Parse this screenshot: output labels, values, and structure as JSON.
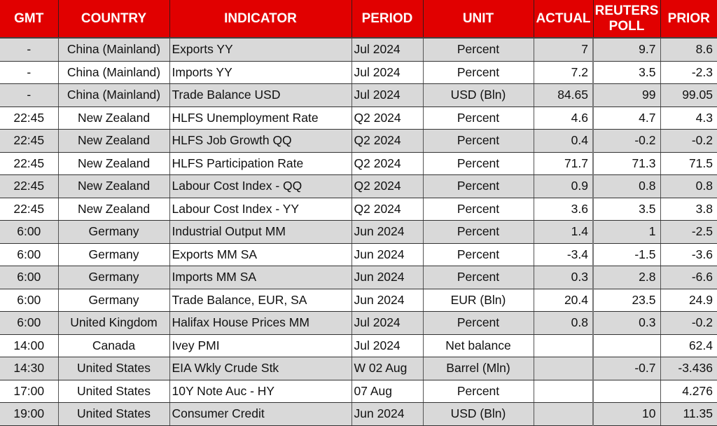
{
  "header": {
    "gmt": "GMT",
    "country": "COUNTRY",
    "indicator": "INDICATOR",
    "period": "PERIOD",
    "unit": "UNIT",
    "actual": "ACTUAL",
    "poll_line1": "REUTERS",
    "poll_line2": "POLL",
    "prior": "PRIOR"
  },
  "colors": {
    "header_bg": "#e10000",
    "header_text": "#ffffff",
    "row_alt_bg": "#d9d9d9",
    "row_bg": "#ffffff"
  },
  "rows": [
    {
      "gmt": "-",
      "country": "China (Mainland)",
      "indicator": "Exports YY",
      "period": "Jul 2024",
      "unit": "Percent",
      "actual": "7",
      "poll": "9.7",
      "prior": "8.6"
    },
    {
      "gmt": "-",
      "country": "China (Mainland)",
      "indicator": "Imports YY",
      "period": "Jul 2024",
      "unit": "Percent",
      "actual": "7.2",
      "poll": "3.5",
      "prior": "-2.3"
    },
    {
      "gmt": "-",
      "country": "China (Mainland)",
      "indicator": "Trade Balance USD",
      "period": "Jul 2024",
      "unit": "USD (Bln)",
      "actual": "84.65",
      "poll": "99",
      "prior": "99.05"
    },
    {
      "gmt": "22:45",
      "country": "New Zealand",
      "indicator": "HLFS Unemployment Rate",
      "period": "Q2 2024",
      "unit": "Percent",
      "actual": "4.6",
      "poll": "4.7",
      "prior": "4.3"
    },
    {
      "gmt": "22:45",
      "country": "New Zealand",
      "indicator": "HLFS Job Growth QQ",
      "period": "Q2 2024",
      "unit": "Percent",
      "actual": "0.4",
      "poll": "-0.2",
      "prior": "-0.2"
    },
    {
      "gmt": "22:45",
      "country": "New Zealand",
      "indicator": "HLFS Participation Rate",
      "period": "Q2 2024",
      "unit": "Percent",
      "actual": "71.7",
      "poll": "71.3",
      "prior": "71.5"
    },
    {
      "gmt": "22:45",
      "country": "New Zealand",
      "indicator": "Labour Cost Index - QQ",
      "period": "Q2 2024",
      "unit": "Percent",
      "actual": "0.9",
      "poll": "0.8",
      "prior": "0.8"
    },
    {
      "gmt": "22:45",
      "country": "New Zealand",
      "indicator": "Labour Cost Index - YY",
      "period": "Q2 2024",
      "unit": "Percent",
      "actual": "3.6",
      "poll": "3.5",
      "prior": "3.8"
    },
    {
      "gmt": "6:00",
      "country": "Germany",
      "indicator": "Industrial Output MM",
      "period": "Jun 2024",
      "unit": "Percent",
      "actual": "1.4",
      "poll": "1",
      "prior": "-2.5"
    },
    {
      "gmt": "6:00",
      "country": "Germany",
      "indicator": "Exports MM SA",
      "period": "Jun 2024",
      "unit": "Percent",
      "actual": "-3.4",
      "poll": "-1.5",
      "prior": "-3.6"
    },
    {
      "gmt": "6:00",
      "country": "Germany",
      "indicator": "Imports MM SA",
      "period": "Jun 2024",
      "unit": "Percent",
      "actual": "0.3",
      "poll": "2.8",
      "prior": "-6.6"
    },
    {
      "gmt": "6:00",
      "country": "Germany",
      "indicator": "Trade Balance, EUR, SA",
      "period": "Jun 2024",
      "unit": "EUR (Bln)",
      "actual": "20.4",
      "poll": "23.5",
      "prior": "24.9"
    },
    {
      "gmt": "6:00",
      "country": "United Kingdom",
      "indicator": "Halifax House Prices MM",
      "period": "Jul 2024",
      "unit": "Percent",
      "actual": "0.8",
      "poll": "0.3",
      "prior": "-0.2"
    },
    {
      "gmt": "14:00",
      "country": "Canada",
      "indicator": "Ivey PMI",
      "period": "Jul 2024",
      "unit": "Net balance",
      "actual": "",
      "poll": "",
      "prior": "62.4"
    },
    {
      "gmt": "14:30",
      "country": "United States",
      "indicator": "EIA Wkly Crude Stk",
      "period": "W 02 Aug",
      "unit": "Barrel (Mln)",
      "actual": "",
      "poll": "-0.7",
      "prior": "-3.436"
    },
    {
      "gmt": "17:00",
      "country": "United States",
      "indicator": "10Y Note Auc - HY",
      "period": "07 Aug",
      "unit": "Percent",
      "actual": "",
      "poll": "",
      "prior": "4.276"
    },
    {
      "gmt": "19:00",
      "country": "United States",
      "indicator": "Consumer Credit",
      "period": "Jun 2024",
      "unit": "USD (Bln)",
      "actual": "",
      "poll": "10",
      "prior": "11.35"
    }
  ]
}
